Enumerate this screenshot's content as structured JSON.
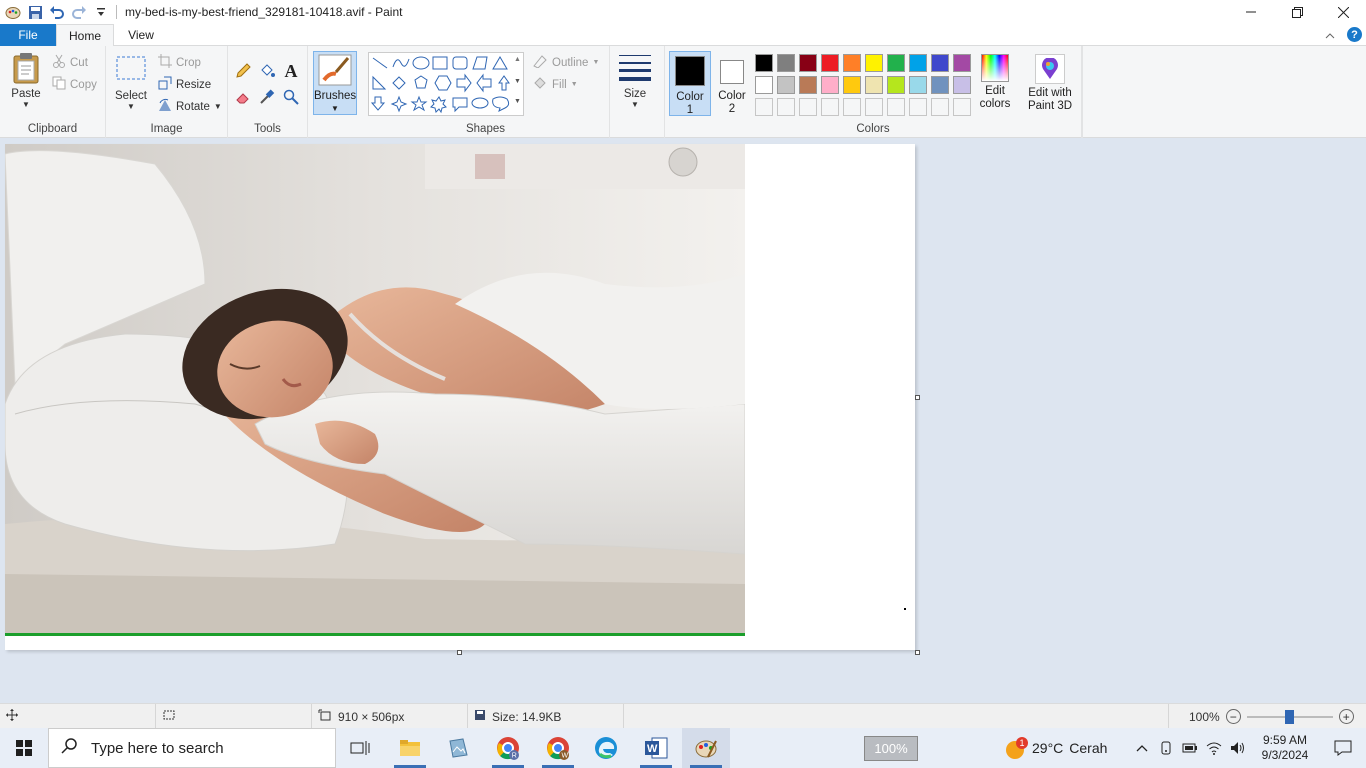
{
  "window": {
    "title": "my-bed-is-my-best-friend_329181-10418.avif - Paint"
  },
  "tabs": {
    "file": "File",
    "home": "Home",
    "view": "View"
  },
  "ribbon": {
    "clipboard": {
      "label": "Clipboard",
      "paste": "Paste",
      "cut": "Cut",
      "copy": "Copy"
    },
    "image": {
      "label": "Image",
      "select": "Select",
      "crop": "Crop",
      "resize": "Resize",
      "rotate": "Rotate"
    },
    "tools": {
      "label": "Tools"
    },
    "brushes": {
      "label": "Brushes"
    },
    "shapes": {
      "label": "Shapes",
      "outline": "Outline",
      "fill": "Fill"
    },
    "size": {
      "label": "Size"
    },
    "colors": {
      "label": "Colors",
      "color1": "Color",
      "color1_num": "1",
      "color2": "Color",
      "color2_num": "2",
      "edit_colors_line1": "Edit",
      "edit_colors_line2": "colors",
      "paint3d_line1": "Edit with",
      "paint3d_line2": "Paint 3D",
      "palette_row1": [
        "#000000",
        "#7f7f7f",
        "#880015",
        "#ed1c24",
        "#ff7f27",
        "#fff200",
        "#22b14c",
        "#00a2e8",
        "#3f48cc",
        "#a349a4"
      ],
      "palette_row2": [
        "#ffffff",
        "#c3c3c3",
        "#b97a57",
        "#ffaec9",
        "#ffc90e",
        "#efe4b0",
        "#b5e61d",
        "#99d9ea",
        "#7092be",
        "#c8bfe7"
      ]
    }
  },
  "status": {
    "dimensions": "910 × 506px",
    "size": "Size: 14.9KB",
    "zoom": "100%"
  },
  "taskbar": {
    "search_placeholder": "Type here to search",
    "zoom_badge": "100%",
    "weather_temp": "29°C",
    "weather_text": "Cerah",
    "weather_badge": "1",
    "time": "9:59 AM",
    "date": "9/3/2024"
  }
}
